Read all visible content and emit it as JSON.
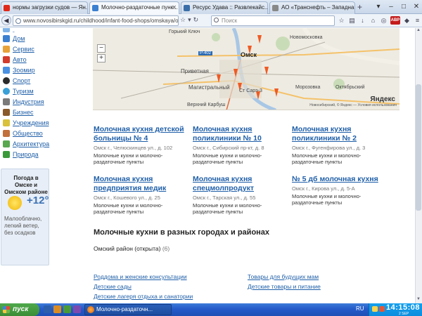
{
  "browser": {
    "tabs": [
      {
        "label": "нормы загрузки судов — Ян...",
        "active": false,
        "favicon_color": "#e0281a"
      },
      {
        "label": "Молочно-раздаточные пунк...",
        "active": true,
        "favicon_color": "#3a7fd0"
      },
      {
        "label": "Ресурс Удава :: Развлекайс...",
        "active": false,
        "favicon_color": "#3b6ea8"
      },
      {
        "label": "АО «Транснефть – Западна...",
        "active": false,
        "favicon_color": "#888888"
      }
    ],
    "new_tab": "+",
    "url": "www.novosibirskgid.ru/childhood/infant-food-shops/omskaya/omsk/",
    "search_placeholder": "Поиск"
  },
  "sidebar": {
    "categories": [
      {
        "label": "Дом",
        "icon": "house-icon",
        "color": "#3b7fd1"
      },
      {
        "label": "Сервис",
        "icon": "wrench-icon",
        "color": "#e8a23a"
      },
      {
        "label": "Авто",
        "icon": "car-icon",
        "color": "#d33b2c"
      },
      {
        "label": "Зоомир",
        "icon": "paw-icon",
        "color": "#4a90e2"
      },
      {
        "label": "Спорт",
        "icon": "ball-icon",
        "color": "#2b2b2b"
      },
      {
        "label": "Туризм",
        "icon": "globe-icon",
        "color": "#3aa0d8"
      },
      {
        "label": "Индустрия",
        "icon": "factory-icon",
        "color": "#7a7a7a"
      },
      {
        "label": "Бизнес",
        "icon": "briefcase-icon",
        "color": "#8a5a2b"
      },
      {
        "label": "Учреждения",
        "icon": "building-icon",
        "color": "#d9c13b"
      },
      {
        "label": "Общество",
        "icon": "people-icon",
        "color": "#c2703c"
      },
      {
        "label": "Архитектура",
        "icon": "column-icon",
        "color": "#5aa850"
      },
      {
        "label": "Природа",
        "icon": "leaf-icon",
        "color": "#3a9a3a"
      }
    ],
    "weather": {
      "title": "Погода в Омске и Омском районе",
      "temp": "+12°",
      "description": "Малооблачно, легкий ветер, без осадков"
    }
  },
  "map": {
    "labels": [
      "Горький Ключ",
      "Омск",
      "Новомосковка",
      "Приветная",
      "Магистральный",
      "Ст Сарэ-3",
      "Верхний Карбуш",
      "Морозовка",
      "Октябрьский",
      "Р-402"
    ],
    "brand": "Яндекс",
    "copyright": "Новосибирский, © Яндекс — Условия использования",
    "zoom_in": "+",
    "zoom_out": "−"
  },
  "kitchens": [
    {
      "title": "Молочная кухня детской больницы № 4",
      "address": "Омск г., Челюскинцев ул., д. 102",
      "type": "Молочные кухни и молочно-раздаточные пункты"
    },
    {
      "title": "Молочная кухня поликлиники № 10",
      "address": "Омск г., Сибирский пр-кт, д. 8",
      "type": "Молочные кухни и молочно-раздаточные пункты"
    },
    {
      "title": "Молочная кухня поликлиники № 2",
      "address": "Омск г., Фугенфирова ул., д. 3",
      "type": "Молочные кухни и молочно-раздаточные пункты"
    },
    {
      "title": "Молочная кухня предприятия медик",
      "address": "Омск г., Кошевого ул., д. 25",
      "type": "Молочные кухни и молочно-раздаточные пункты"
    },
    {
      "title": "Молочная кухня спецмолпродукт",
      "address": "Омск г., Тарская ул., д. 55",
      "type": "Молочные кухни и молочно-раздаточные пункты"
    },
    {
      "title": "№ 5 дб молочная кухня",
      "address": "Омск г., Кирова ул., д. 5-А",
      "type": "Молочные кухни и молочно-раздаточные пункты"
    }
  ],
  "other": {
    "heading": "Молочные кухни в разных городах и районах",
    "region": "Омский район (открыта)",
    "region_count": "(6)"
  },
  "related_links": [
    "Роддома и женские консультации",
    "Товары для будущих мам",
    "Детские сады",
    "Детские товары и питание",
    "Детские лагеря отдыха и санатории"
  ],
  "taskbar": {
    "start": "пуск",
    "task": "Молочно-раздаточн...",
    "lang": "RU",
    "time": "14:15:08",
    "date": "2 SEP"
  }
}
